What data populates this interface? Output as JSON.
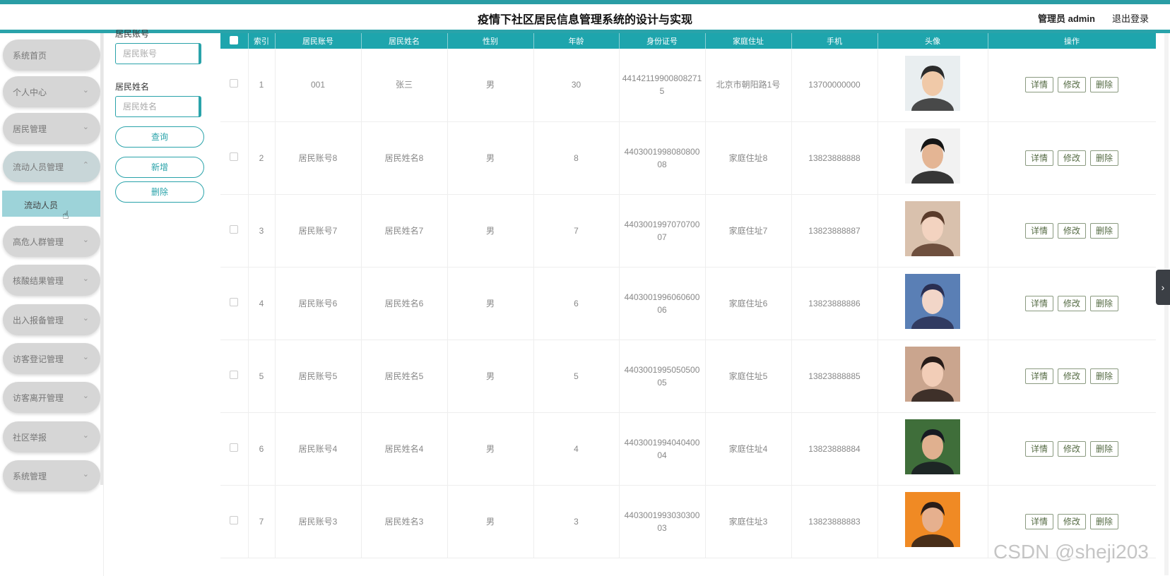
{
  "header": {
    "title": "疫情下社区居民信息管理系统的设计与实现",
    "admin": "管理员 admin",
    "logout": "退出登录"
  },
  "sidebar": {
    "items": [
      {
        "label": "系统首页",
        "chev": ""
      },
      {
        "label": "个人中心",
        "chev": "⌄"
      },
      {
        "label": "居民管理",
        "chev": "⌄"
      },
      {
        "label": "流动人员管理",
        "chev": "⌃"
      },
      {
        "label": "高危人群管理",
        "chev": "⌄"
      },
      {
        "label": "核酸结果管理",
        "chev": "⌄"
      },
      {
        "label": "出入报备管理",
        "chev": "⌄"
      },
      {
        "label": "访客登记管理",
        "chev": "⌄"
      },
      {
        "label": "访客离开管理",
        "chev": "⌄"
      },
      {
        "label": "社区举报",
        "chev": "⌄"
      },
      {
        "label": "系统管理",
        "chev": "⌄"
      }
    ],
    "submenu": "流动人员"
  },
  "filter": {
    "account_label": "居民账号",
    "account_placeholder": "居民账号",
    "name_label": "居民姓名",
    "name_placeholder": "居民姓名",
    "query": "查询",
    "add": "新增",
    "delete": "删除"
  },
  "table": {
    "headers": [
      "",
      "索引",
      "居民账号",
      "居民姓名",
      "性别",
      "年龄",
      "身份证号",
      "家庭住址",
      "手机",
      "头像",
      "操作"
    ],
    "rows": [
      {
        "index": "1",
        "account": "001",
        "name": "张三",
        "gender": "男",
        "age": "30",
        "id": "441421199008082715",
        "address": "北京市朝阳路1号",
        "phone": "13700000000",
        "avatar": "a1"
      },
      {
        "index": "2",
        "account": "居民账号8",
        "name": "居民姓名8",
        "gender": "男",
        "age": "8",
        "id": "440300199808080008",
        "address": "家庭住址8",
        "phone": "13823888888",
        "avatar": "a2"
      },
      {
        "index": "3",
        "account": "居民账号7",
        "name": "居民姓名7",
        "gender": "男",
        "age": "7",
        "id": "440300199707070007",
        "address": "家庭住址7",
        "phone": "13823888887",
        "avatar": "a3"
      },
      {
        "index": "4",
        "account": "居民账号6",
        "name": "居民姓名6",
        "gender": "男",
        "age": "6",
        "id": "440300199606060006",
        "address": "家庭住址6",
        "phone": "13823888886",
        "avatar": "a4"
      },
      {
        "index": "5",
        "account": "居民账号5",
        "name": "居民姓名5",
        "gender": "男",
        "age": "5",
        "id": "440300199505050005",
        "address": "家庭住址5",
        "phone": "13823888885",
        "avatar": "a5"
      },
      {
        "index": "6",
        "account": "居民账号4",
        "name": "居民姓名4",
        "gender": "男",
        "age": "4",
        "id": "440300199404040004",
        "address": "家庭住址4",
        "phone": "13823888884",
        "avatar": "a6"
      },
      {
        "index": "7",
        "account": "居民账号3",
        "name": "居民姓名3",
        "gender": "男",
        "age": "3",
        "id": "440300199303030003",
        "address": "家庭住址3",
        "phone": "13823888883",
        "avatar": "a7"
      }
    ],
    "actions": {
      "detail": "详情",
      "edit": "修改",
      "delete": "删除"
    }
  },
  "watermark": "CSDN @sheji203",
  "side_tab_icon": "›"
}
